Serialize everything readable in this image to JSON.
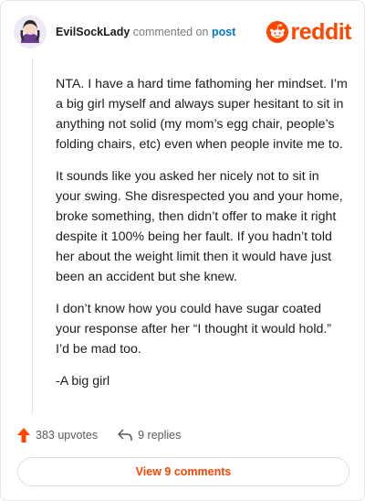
{
  "header": {
    "username": "EvilSockLady",
    "action_text": "commented on",
    "post_link": "post",
    "brand": "reddit"
  },
  "comment": {
    "paragraphs": [
      "NTA. I have a hard time fathoming her mindset. I’m a big girl myself and always super hesitant to sit in anything not solid (my mom’s egg chair, people’s folding chairs, etc) even when people invite me to.",
      "It sounds like you asked her nicely not to sit in your swing. She disrespected you and your home, broke something, then didn’t offer to make it right despite it 100% being her fault. If you hadn’t told her about the weight limit then it would have just been an accident but she knew.",
      "I don’t know how you could have sugar coated your response after her “I thought it would hold.” I’d be mad too.",
      "-A big girl"
    ]
  },
  "actions": {
    "upvotes": "383 upvotes",
    "replies": "9 replies"
  },
  "footer": {
    "view_comments": "View 9 comments"
  },
  "colors": {
    "brand": "#ff4500",
    "link": "#0079d3"
  },
  "icons": [
    "avatar-icon",
    "reddit-logo-icon",
    "upvote-arrow-icon",
    "reply-arrow-icon"
  ]
}
